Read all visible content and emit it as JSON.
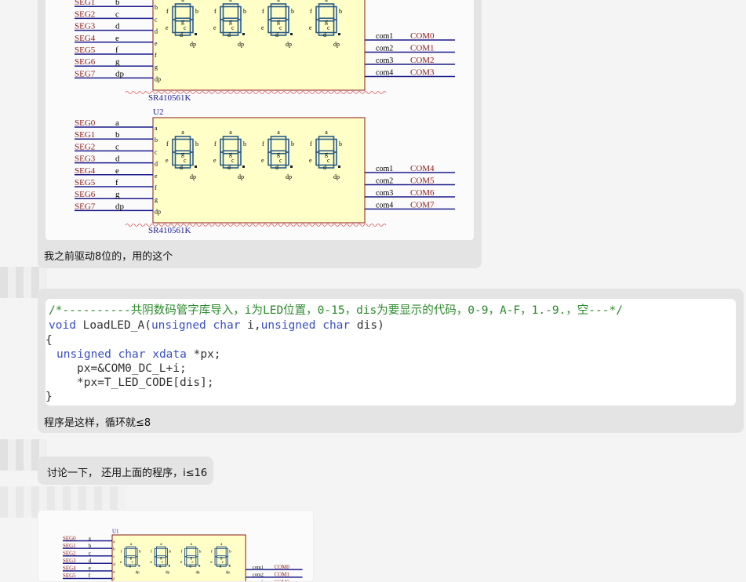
{
  "messages": [
    {
      "text": "我之前驱动8位的，用的这个"
    },
    {
      "text": "程序是这样，循环就≤8"
    },
    {
      "text": "讨论一下， 还用上面的程序，i≤16"
    }
  ],
  "schematic": {
    "seg_nets": [
      "SEG0",
      "SEG1",
      "SEG2",
      "SEG3",
      "SEG4",
      "SEG5",
      "SEG6",
      "SEG7"
    ],
    "seg_pins": [
      "a",
      "b",
      "c",
      "d",
      "e",
      "f",
      "g",
      "dp"
    ],
    "inner_pins": [
      "a",
      "b",
      "c",
      "d",
      "e",
      "f",
      "g",
      "dp"
    ],
    "com_pins": [
      "com1",
      "com2",
      "com3",
      "com4"
    ],
    "u1_com_nets": [
      "COM0",
      "COM1",
      "COM2",
      "COM3"
    ],
    "u2_com_nets": [
      "COM4",
      "COM5",
      "COM6",
      "COM7"
    ],
    "u1_label": "U1",
    "u2_label": "U2",
    "part": "SR410561K",
    "digit_labels": {
      "a": "a",
      "b": "b",
      "c": "c",
      "d": "d",
      "e": "e",
      "f": "f",
      "g": "g",
      "dp": "dp"
    }
  },
  "code": {
    "comment": "/*----------共阴数码管字库导入，i为LED位置，0-15，dis为要显示的代码，0-9，A-F，1.-9.，空---*/",
    "line2_kw": "void",
    "line2_fn": " LoadLED_A(",
    "line2_t1": "unsigned char",
    "line2_a1": " i,",
    "line2_t2": "unsigned char",
    "line2_a2": " dis)",
    "brace_open": "{",
    "line4_t": "unsigned char xdata",
    "line4_v": " *px;",
    "line5": "px=&COM0_DC_L+i;",
    "line6": "*px=T_LED_CODE[dis];",
    "brace_close": "}"
  },
  "colors": {
    "bubble": "#e4e4e4",
    "chip_fill": "#ffffc8",
    "net_red": "#8b1a1a",
    "net_blue": "#1a1a8b",
    "segment": "#2a5a88"
  }
}
